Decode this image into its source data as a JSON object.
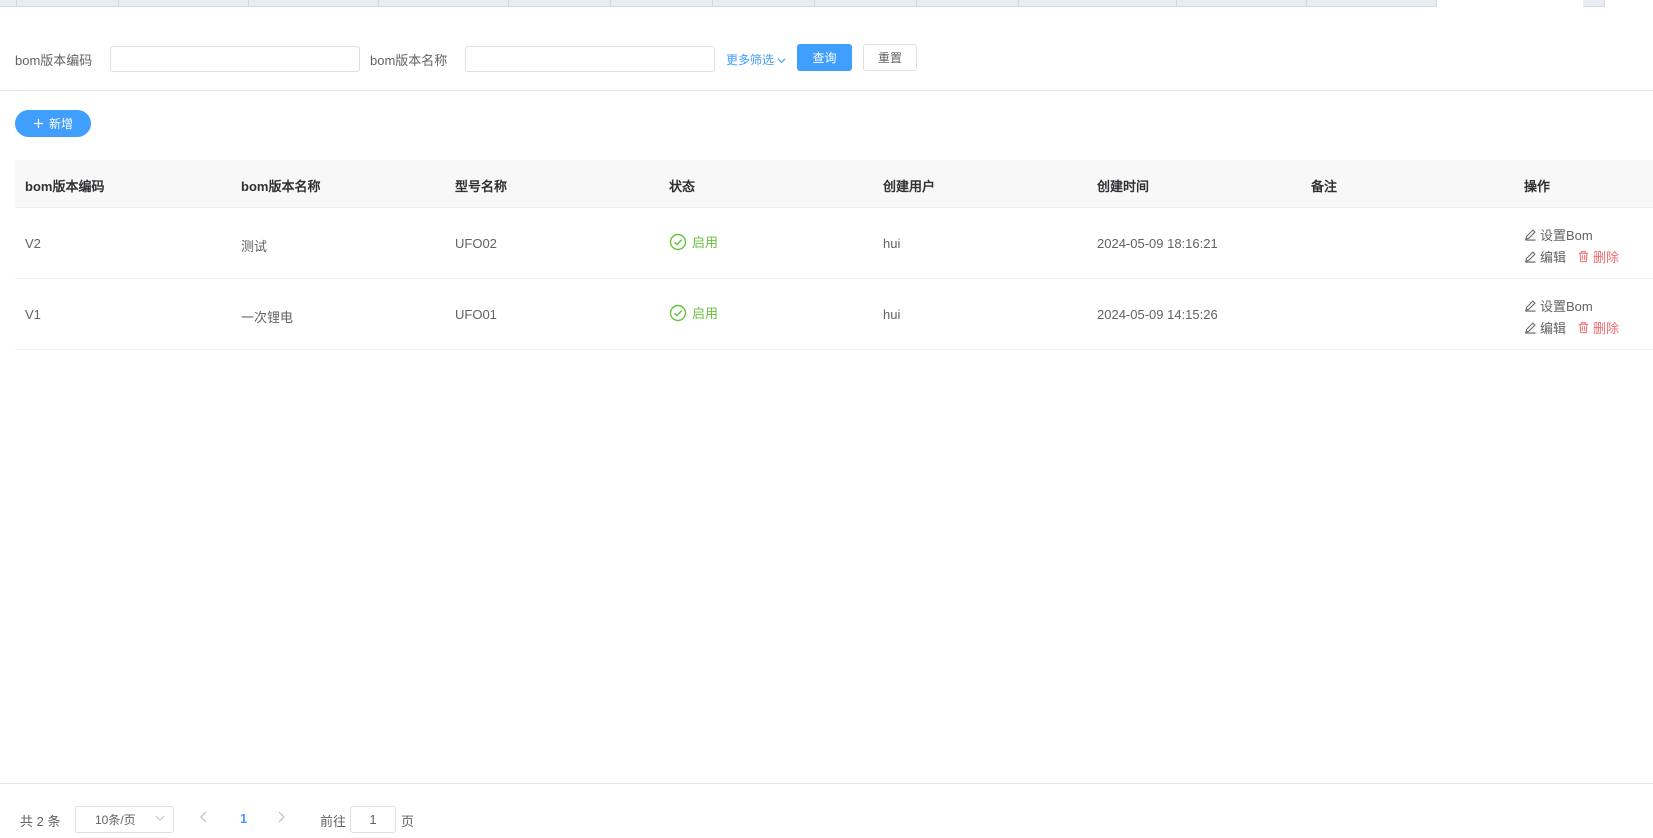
{
  "search": {
    "code_label": "bom版本编码",
    "name_label": "bom版本名称",
    "more_filter": "更多筛选",
    "query_button": "查询",
    "reset_button": "重置"
  },
  "toolbar": {
    "add_button": "新增"
  },
  "table": {
    "columns": [
      "bom版本编码",
      "bom版本名称",
      "型号名称",
      "状态",
      "创建用户",
      "创建时间",
      "备注",
      "操作"
    ],
    "rows": [
      {
        "code": "V2",
        "name": "测试",
        "model": "UFO02",
        "status": "启用",
        "user": "hui",
        "created": "2024-05-09 18:16:21",
        "remark": ""
      },
      {
        "code": "V1",
        "name": "一次锂电",
        "model": "UFO01",
        "status": "启用",
        "user": "hui",
        "created": "2024-05-09 14:15:26",
        "remark": ""
      }
    ],
    "actions": {
      "set_bom": "设置Bom",
      "edit": "编辑",
      "delete": "删除"
    }
  },
  "pagination": {
    "total": "共 2 条",
    "page_size": "10条/页",
    "current": "1",
    "goto_prefix": "前往",
    "goto_value": "1",
    "goto_suffix": "页"
  },
  "colors": {
    "primary": "#409eff",
    "success": "#67c23a",
    "danger": "#f56c6c"
  }
}
